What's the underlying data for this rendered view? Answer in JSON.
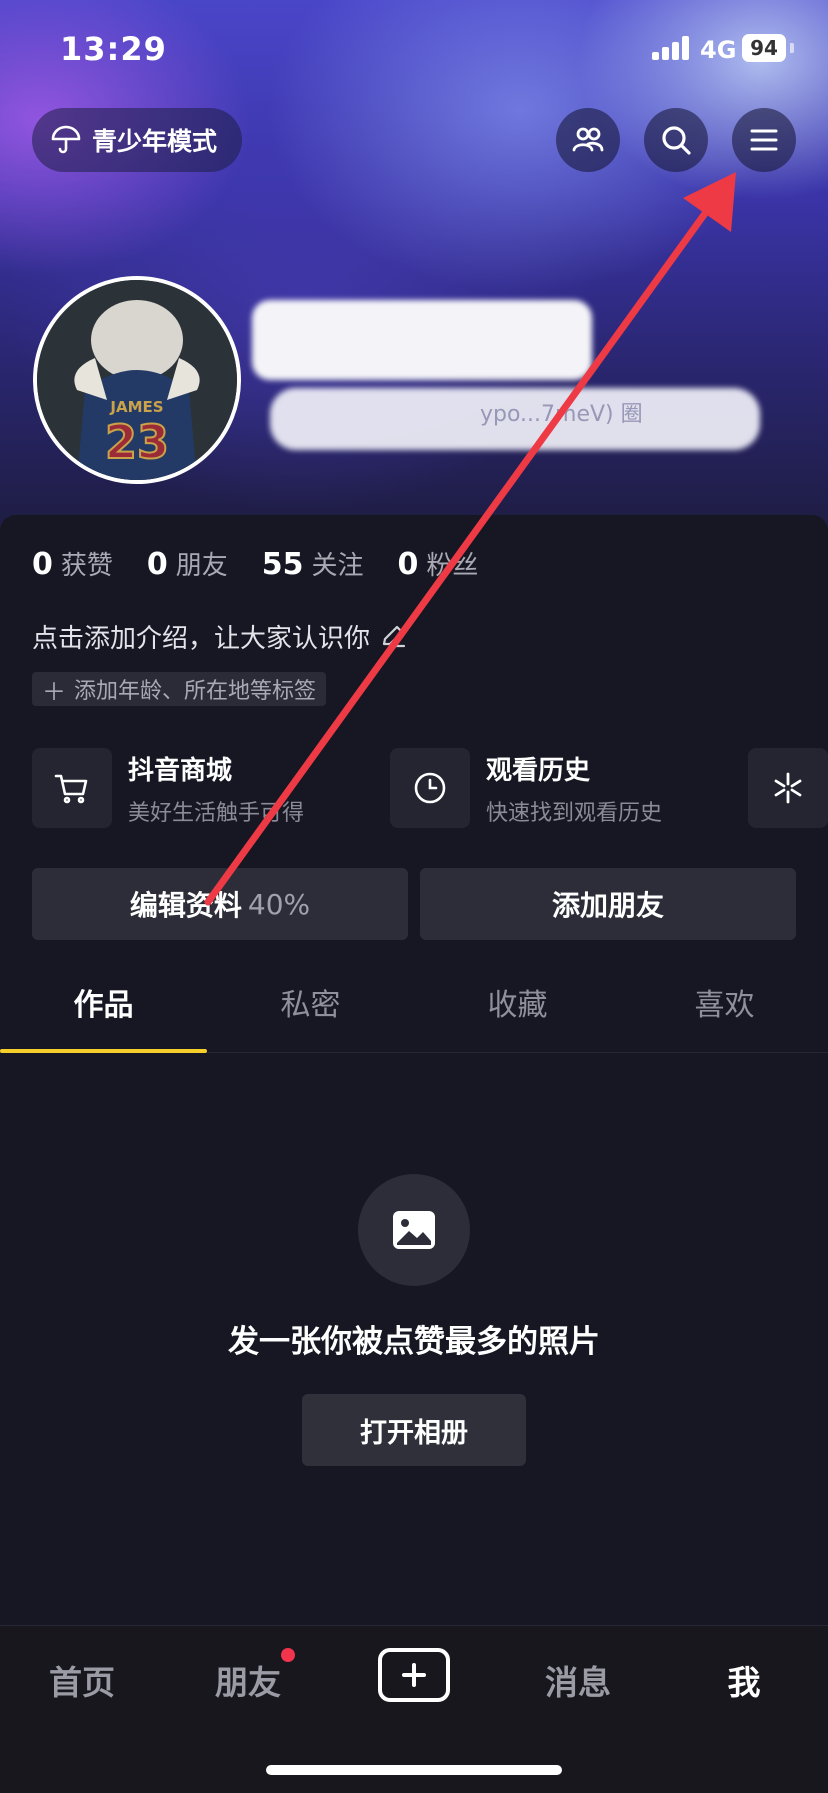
{
  "status_bar": {
    "time": "13:29",
    "network": "4G",
    "battery": "94"
  },
  "header": {
    "teen_mode_label": "青少年模式",
    "friends_icon": "people-icon",
    "search_icon": "search-icon",
    "menu_icon": "hamburger-menu-icon"
  },
  "profile": {
    "avatar_jersey_name": "JAMES",
    "avatar_jersey_number": "23",
    "handle_fragment": "ypo...7meV) 圈"
  },
  "stats": [
    {
      "value": "0",
      "label": "获赞"
    },
    {
      "value": "0",
      "label": "朋友"
    },
    {
      "value": "55",
      "label": "关注"
    },
    {
      "value": "0",
      "label": "粉丝"
    }
  ],
  "bio": {
    "placeholder": "点击添加介绍，让大家认识你"
  },
  "tag": {
    "label": "添加年龄、所在地等标签"
  },
  "services": [
    {
      "title": "抖音商城",
      "subtitle": "美好生活触手可得",
      "icon": "cart-icon"
    },
    {
      "title": "观看历史",
      "subtitle": "快速找到观看历史",
      "icon": "clock-icon"
    }
  ],
  "actions": {
    "edit_label": "编辑资料",
    "edit_progress": "40%",
    "add_friend_label": "添加朋友"
  },
  "tabs": [
    "作品",
    "私密",
    "收藏",
    "喜欢"
  ],
  "empty_state": {
    "text": "发一张你被点赞最多的照片",
    "button": "打开相册",
    "icon": "image-icon"
  },
  "bottom_nav": {
    "home": "首页",
    "friends": "朋友",
    "messages": "消息",
    "me": "我"
  },
  "colors": {
    "accent_tab": "#f6cf2a",
    "annotation_arrow": "#ee3a45",
    "notification_dot": "#f2344c",
    "panel_bg": "#161722"
  }
}
